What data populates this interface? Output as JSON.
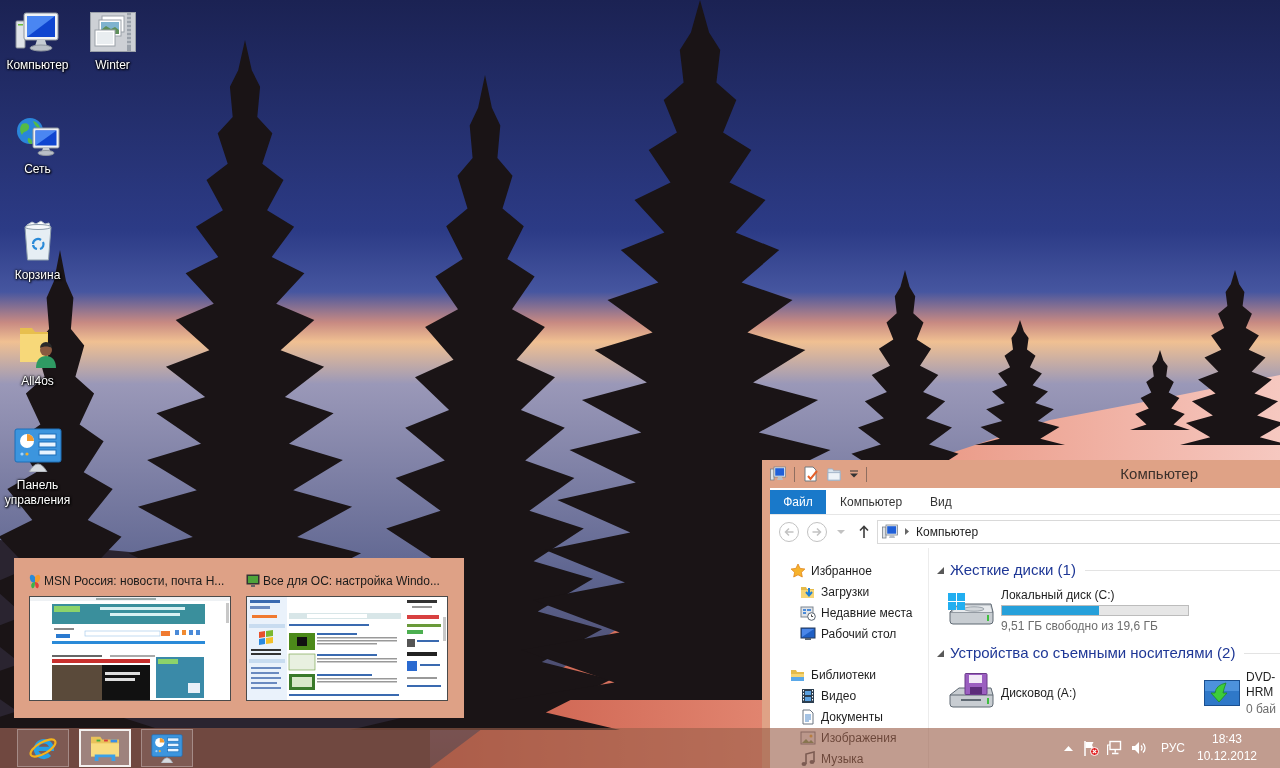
{
  "desktop_icons": [
    {
      "kind": "computer",
      "label": "Компьютер"
    },
    {
      "kind": "network",
      "label": "Сеть"
    },
    {
      "kind": "recycle-bin",
      "label": "Корзина"
    },
    {
      "kind": "user-folder",
      "label": "All4os"
    },
    {
      "kind": "control-panel",
      "label": "Панель управления"
    },
    {
      "kind": "photo-archive",
      "label": "Winter"
    }
  ],
  "thumbnail_popup": {
    "windows": [
      {
        "kind": "news-portal",
        "title": "MSN Россия: новости, почта Н..."
      },
      {
        "kind": "tech-site",
        "title": "Все для ОС: настройка Windo..."
      }
    ]
  },
  "explorer": {
    "title": "Компьютер",
    "ribbon_tabs": [
      {
        "kind": "file-menu",
        "label": "Файл"
      },
      {
        "kind": "tab",
        "label": "Компьютер"
      },
      {
        "kind": "tab",
        "label": "Вид"
      }
    ],
    "nav_buttons": [
      {
        "kind": "back",
        "disabled": true
      },
      {
        "kind": "forward",
        "disabled": true
      },
      {
        "kind": "recent",
        "disabled": true
      },
      {
        "kind": "up",
        "disabled": false
      }
    ],
    "address_path": [
      "Компьютер"
    ],
    "navigation_pane": [
      {
        "kind": "favorites",
        "label": "Избранное",
        "children": [
          {
            "kind": "downloads",
            "label": "Загрузки"
          },
          {
            "kind": "recent-places",
            "label": "Недавние места"
          },
          {
            "kind": "desktop",
            "label": "Рабочий стол"
          }
        ]
      },
      {
        "kind": "libraries",
        "label": "Библиотеки",
        "children": [
          {
            "kind": "video",
            "label": "Видео"
          },
          {
            "kind": "documents",
            "label": "Документы"
          },
          {
            "kind": "pictures",
            "label": "Изображения"
          },
          {
            "kind": "music",
            "label": "Музыка"
          }
        ]
      }
    ],
    "groups": [
      {
        "title": "Жесткие диски (1)",
        "expanded": true,
        "items": [
          {
            "kind": "hard-disk",
            "name": "Локальный диск (C:)",
            "level": 0.52,
            "detail": "9,51 ГБ свободно из 19,6 ГБ"
          }
        ]
      },
      {
        "title": "Устройства со съемными носителями (2)",
        "expanded": true,
        "items": [
          {
            "kind": "floppy",
            "name": "Дисковод (A:)"
          },
          {
            "kind": "dvd",
            "name_lines": [
              "DVD-",
              "HRM"
            ],
            "detail": "0 бай"
          }
        ]
      }
    ]
  },
  "taskbar": {
    "apps": [
      {
        "kind": "browser",
        "selected": false
      },
      {
        "kind": "file-explorer",
        "selected": true
      },
      {
        "kind": "control-panel",
        "selected": false
      }
    ],
    "language": "РУС",
    "time": "18:43",
    "date": "10.12.2012"
  }
}
